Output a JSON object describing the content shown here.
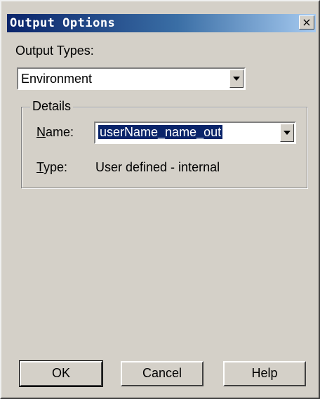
{
  "window": {
    "title": "Output Options",
    "close_glyph": "×"
  },
  "output_types": {
    "label": "Output Types:",
    "selected": "Environment"
  },
  "details": {
    "group_label": "Details",
    "name_label": "Name:",
    "name_value": "userName_name_out",
    "type_label": "Type:",
    "type_value": "User defined - internal"
  },
  "buttons": {
    "ok": "OK",
    "cancel": "Cancel",
    "help": "Help"
  },
  "colors": {
    "title_bar_start": "#0a246a",
    "title_bar_end": "#a6caf0",
    "dialog_face": "#d4d0c8",
    "selection": "#0a246a"
  }
}
